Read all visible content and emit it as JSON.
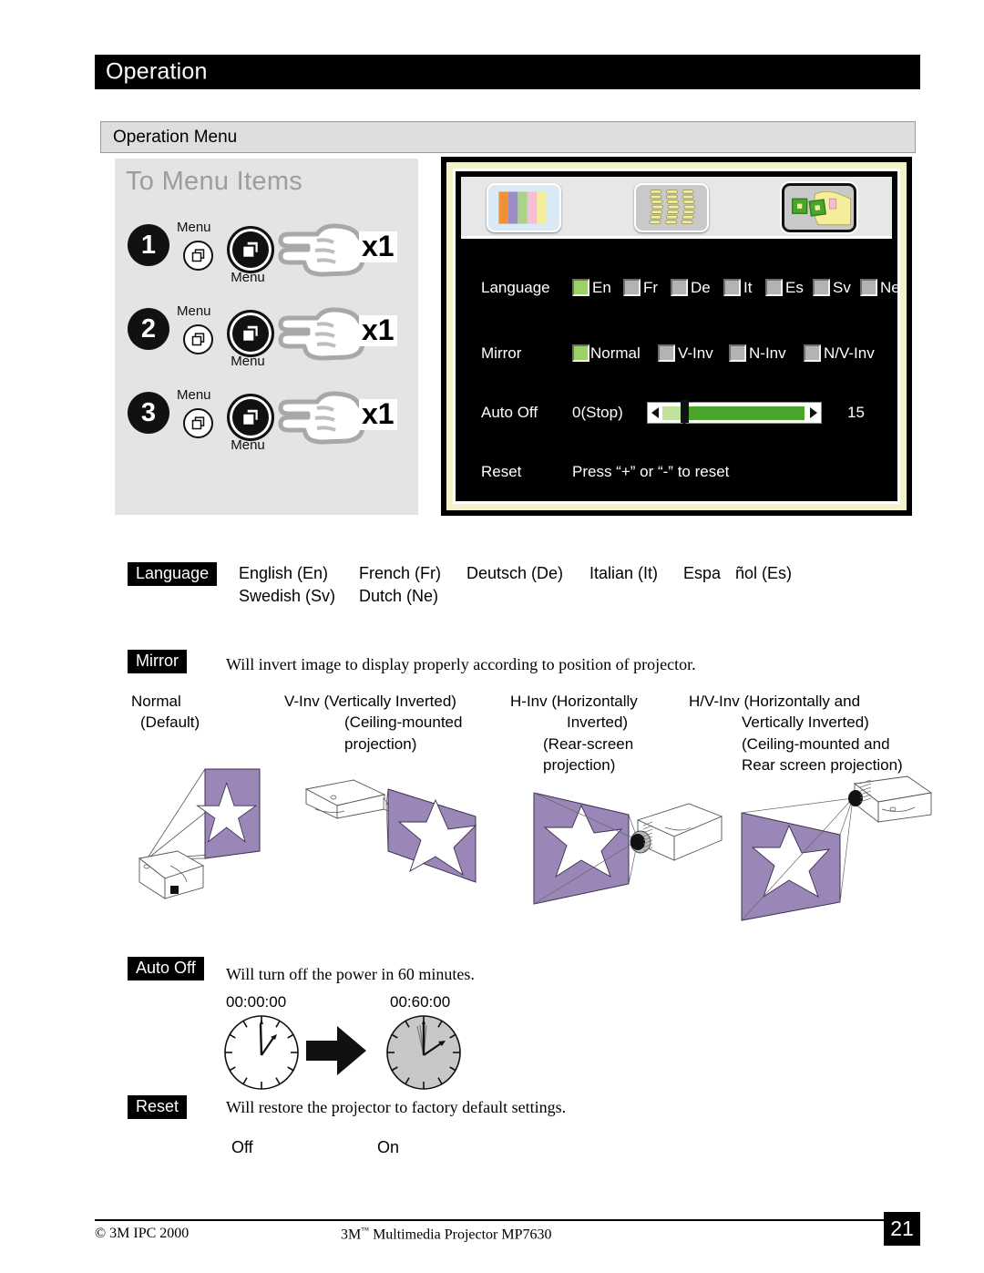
{
  "header": {
    "chapter_title": "Operation",
    "section_title": "Operation Menu"
  },
  "steps_panel": {
    "title": "To Menu Items",
    "steps": [
      {
        "number": "1",
        "small_label": "Menu",
        "button_label": "Menu",
        "press_count": "x1"
      },
      {
        "number": "2",
        "small_label": "Menu",
        "button_label": "Menu",
        "press_count": "x1"
      },
      {
        "number": "3",
        "small_label": "Menu",
        "button_label": "Menu",
        "press_count": "x1"
      }
    ]
  },
  "osd": {
    "icons": [
      {
        "name": "color-bars-icon",
        "selected": false
      },
      {
        "name": "keystone-icon",
        "selected": false
      },
      {
        "name": "operation-hand-icon",
        "selected": true
      }
    ],
    "language_row": {
      "label": "Language",
      "options": [
        {
          "code": "En",
          "selected": true
        },
        {
          "code": "Fr",
          "selected": false
        },
        {
          "code": "De",
          "selected": false
        },
        {
          "code": "It",
          "selected": false
        },
        {
          "code": "Es",
          "selected": false
        },
        {
          "code": "Sv",
          "selected": false
        },
        {
          "code": "Ne",
          "selected": false
        }
      ]
    },
    "mirror_row": {
      "label": "Mirror",
      "options": [
        {
          "code": "Normal",
          "selected": true
        },
        {
          "code": "V-Inv",
          "selected": false
        },
        {
          "code": "N-Inv",
          "selected": false
        },
        {
          "code": "N/V-Inv",
          "selected": false
        }
      ]
    },
    "auto_off_row": {
      "label": "Auto Off",
      "min_label": "0(Stop)",
      "max_label": "15"
    },
    "reset_row": {
      "label": "Reset",
      "hint": "Press “+” or “-” to reset"
    }
  },
  "language_section": {
    "tag": "Language",
    "row1": [
      "English (En)",
      "French (Fr)",
      "Deutsch (De)",
      "Italian (It)",
      "Espa",
      "ñol (Es)"
    ],
    "row2": [
      "Swedish (Sv)",
      "Dutch (Ne)"
    ]
  },
  "mirror_section": {
    "tag": "Mirror",
    "description": "Will invert image to display properly according to position of projector.",
    "columns": [
      {
        "lines": [
          "Normal",
          "(Default)"
        ],
        "art": "projector-front-table"
      },
      {
        "lines": [
          "V-Inv (Vertically Inverted)",
          "(Ceiling-mounted",
          "projection)"
        ],
        "art": "projector-ceiling"
      },
      {
        "lines": [
          "H-Inv (Horizontally",
          "Inverted)",
          "(Rear-screen",
          "projection)"
        ],
        "art": "projector-rear-screen"
      },
      {
        "lines": [
          "H/V-Inv (Horizontally and",
          "Vertically Inverted)",
          "(Ceiling-mounted and",
          "Rear screen projection)"
        ],
        "art": "projector-ceiling-rear"
      }
    ]
  },
  "auto_off_section": {
    "tag": "Auto Off",
    "description": "Will turn off the power in 60 minutes.",
    "clock_start": "00:00:00",
    "clock_end": "00:60:00"
  },
  "reset_section": {
    "tag": "Reset",
    "description": "Will restore the projector to factory default settings.",
    "off_label": "Off",
    "on_label": "On"
  },
  "footer": {
    "copyright": "© 3M IPC 2000",
    "center_pre": "3M",
    "center_tm": "™",
    "center_post": " Multimedia Projector MP7630",
    "page_number": "21"
  },
  "colors": {
    "accent_green": "#49a52b",
    "checkbox_selected": "#9ed163",
    "screen_purple": "#9a87b8",
    "osd_frame_yellow": "#f4f2c8"
  }
}
